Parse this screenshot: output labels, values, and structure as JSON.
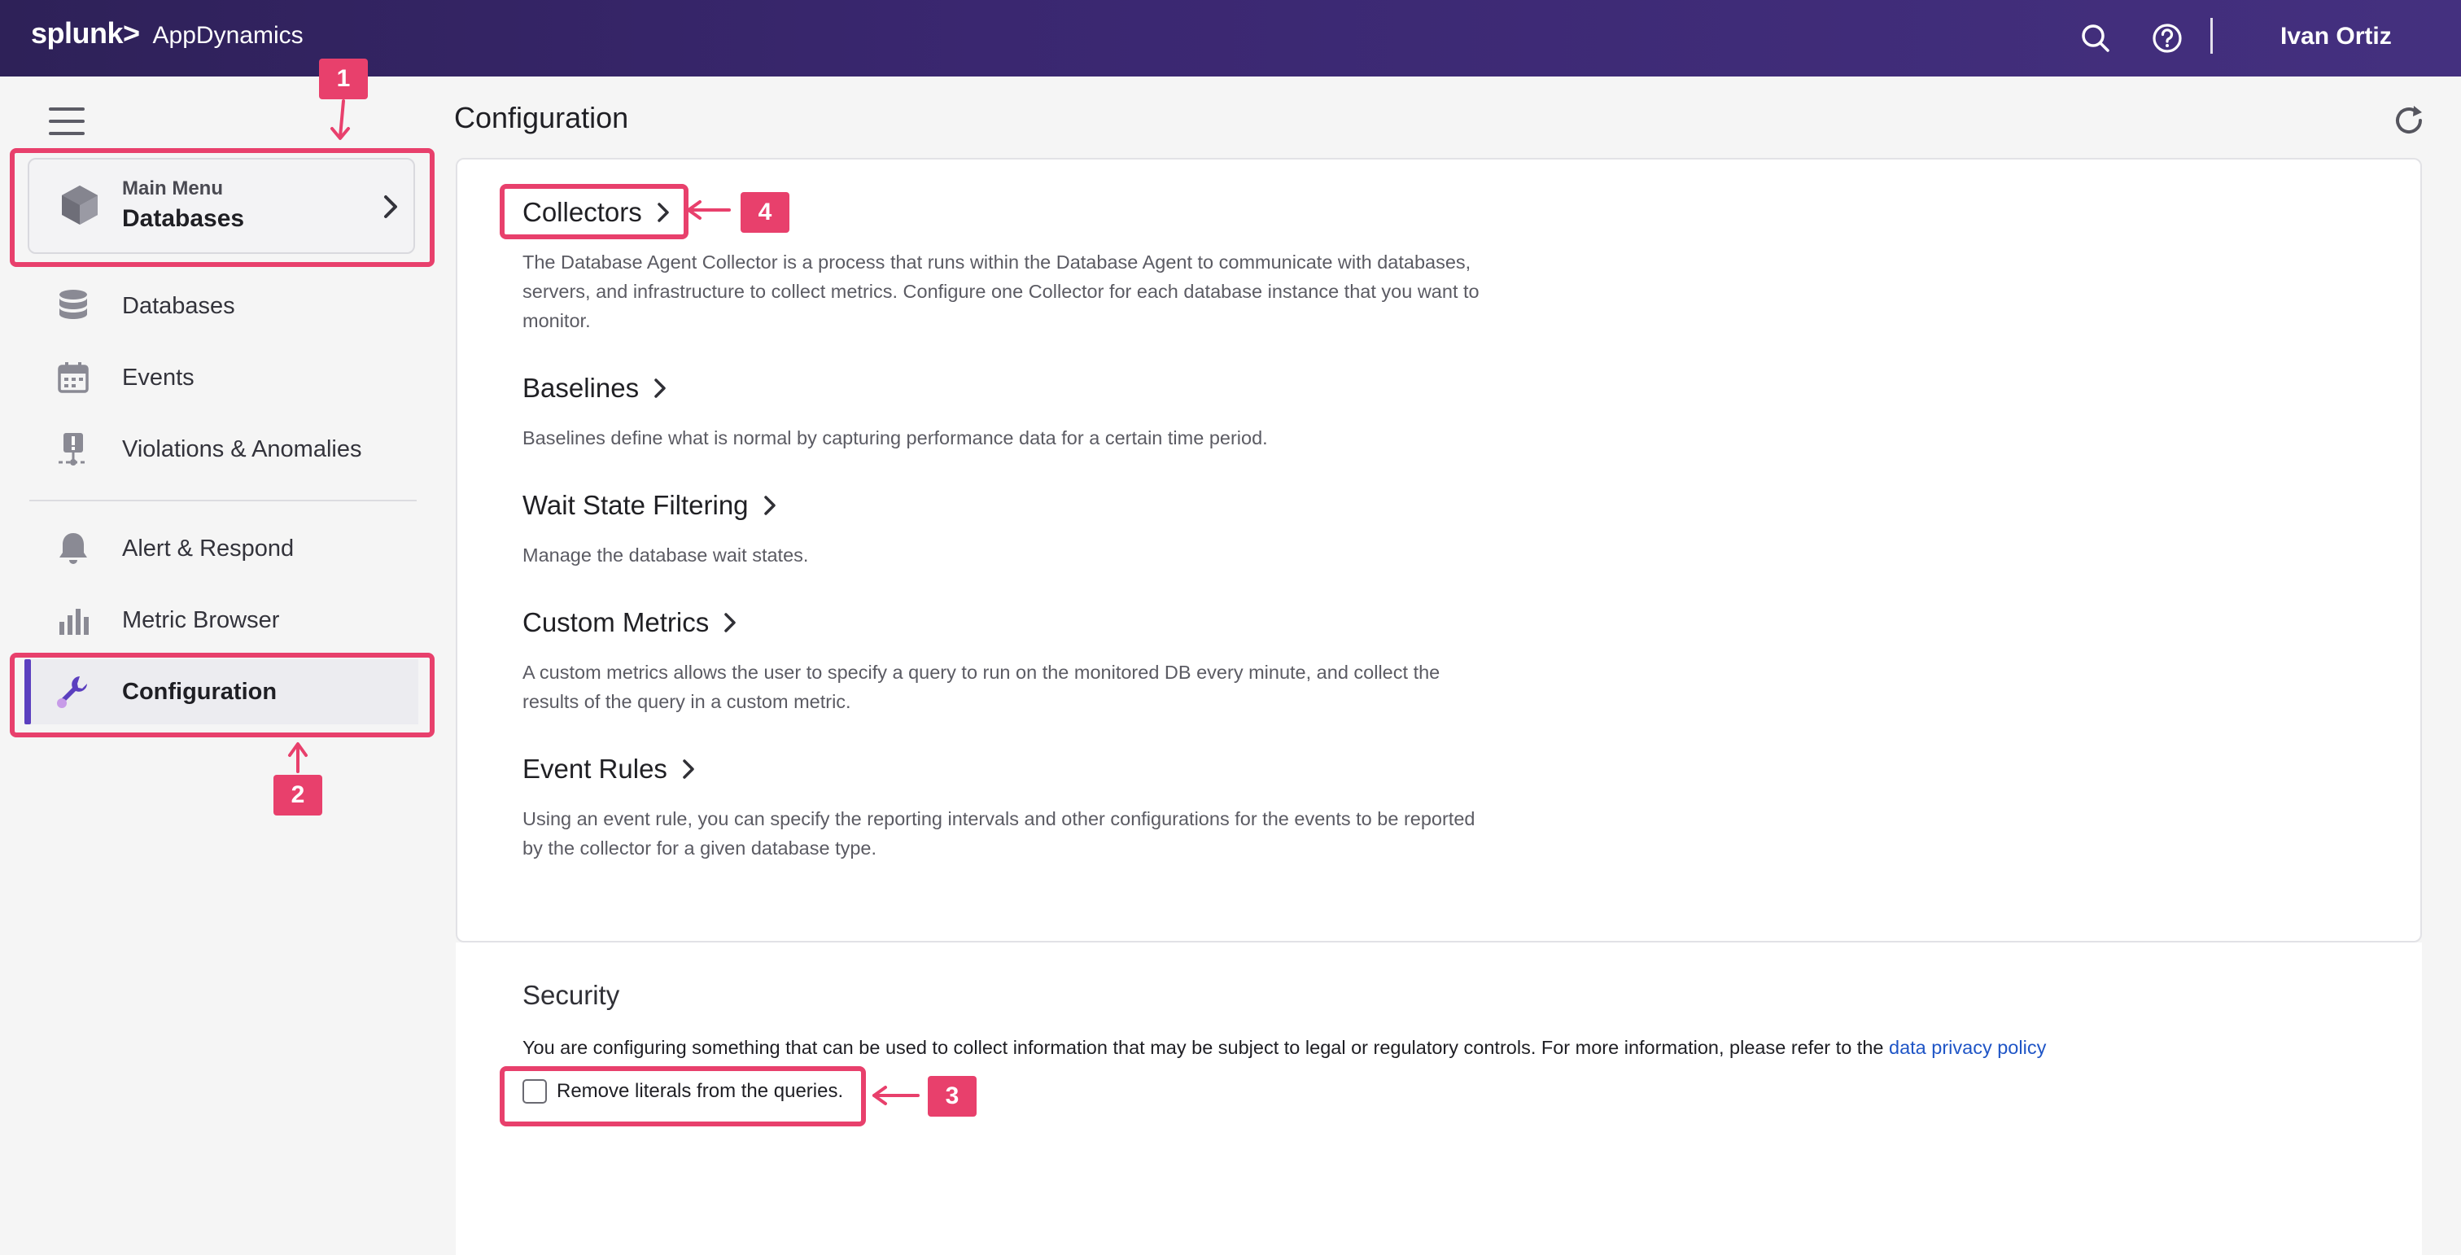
{
  "header": {
    "brand": "splunk>",
    "product": "AppDynamics",
    "user_name": "Ivan Ortiz",
    "icons": [
      "search-icon",
      "help-icon"
    ]
  },
  "sidebar": {
    "main_menu": {
      "small_label": "Main Menu",
      "big_label": "Databases"
    },
    "items": [
      {
        "label": "Databases",
        "icon": "database-icon"
      },
      {
        "label": "Events",
        "icon": "calendar-icon"
      },
      {
        "label": "Violations & Anomalies",
        "icon": "violation-icon"
      },
      {
        "label": "Alert & Respond",
        "icon": "bell-icon"
      },
      {
        "label": "Metric Browser",
        "icon": "bar-chart-icon"
      },
      {
        "label": "Configuration",
        "icon": "wrench-icon",
        "active": true
      }
    ]
  },
  "main": {
    "title": "Configuration",
    "sections": [
      {
        "title": "Collectors",
        "description": "The Database Agent Collector is a process that runs within the Database Agent to communicate with databases, servers, and infrastructure to collect metrics. Configure one Collector for each database instance that you want to monitor."
      },
      {
        "title": "Baselines",
        "description": "Baselines define what is normal by capturing performance data for a certain time period."
      },
      {
        "title": "Wait State Filtering",
        "description": "Manage the database wait states."
      },
      {
        "title": "Custom Metrics",
        "description": "A custom metrics allows the user to specify a query to run on the monitored DB every minute, and collect the results of the query in a custom metric."
      },
      {
        "title": "Event Rules",
        "description": "Using an event rule, you can specify the reporting intervals and other configurations for the events to be reported by the collector for a given database type."
      }
    ],
    "security": {
      "title": "Security",
      "text": "You are configuring something that can be used to collect information that may be subject to legal or regulatory controls. For more information, please refer to the",
      "link": "data privacy policy",
      "checkbox_label": "Remove literals from the queries.",
      "checkbox_checked": false
    }
  },
  "annotations": {
    "badges": [
      "1",
      "2",
      "3",
      "4"
    ],
    "color": "#e8406c"
  },
  "colors": {
    "topbar": "#3a2770",
    "active_accent": "#5b3fbf",
    "link": "#1f55c6"
  }
}
